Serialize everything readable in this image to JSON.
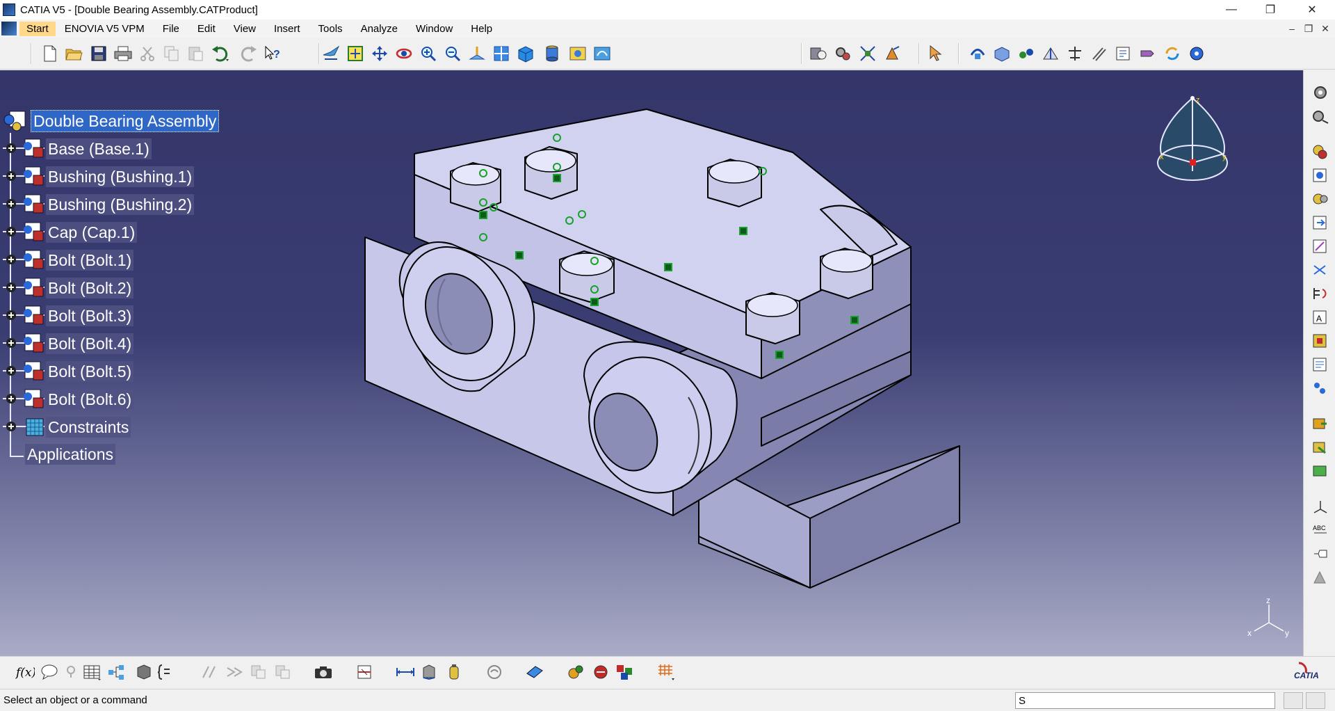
{
  "window": {
    "title": "CATIA V5 - [Double Bearing Assembly.CATProduct]",
    "controls": {
      "minimize": "—",
      "maximize": "❐",
      "close": "✕"
    }
  },
  "menubar": {
    "items": [
      {
        "label": "Start"
      },
      {
        "label": "ENOVIA V5 VPM"
      },
      {
        "label": "File"
      },
      {
        "label": "Edit"
      },
      {
        "label": "View"
      },
      {
        "label": "Insert"
      },
      {
        "label": "Tools"
      },
      {
        "label": "Analyze"
      },
      {
        "label": "Window"
      },
      {
        "label": "Help"
      }
    ],
    "doc_controls": {
      "minimize": "–",
      "restore": "❐",
      "close": "✕"
    }
  },
  "spec_tree": {
    "root": "Double Bearing Assembly",
    "children": [
      {
        "label": "Base (Base.1)",
        "icon": "part-instance-icon"
      },
      {
        "label": "Bushing (Bushing.1)",
        "icon": "part-instance-icon"
      },
      {
        "label": "Bushing (Bushing.2)",
        "icon": "part-instance-icon"
      },
      {
        "label": "Cap (Cap.1)",
        "icon": "part-instance-icon"
      },
      {
        "label": "Bolt (Bolt.1)",
        "icon": "part-instance-icon"
      },
      {
        "label": "Bolt (Bolt.2)",
        "icon": "part-instance-icon"
      },
      {
        "label": "Bolt (Bolt.3)",
        "icon": "part-instance-icon"
      },
      {
        "label": "Bolt (Bolt.4)",
        "icon": "part-instance-icon"
      },
      {
        "label": "Bolt (Bolt.5)",
        "icon": "part-instance-icon"
      },
      {
        "label": "Bolt (Bolt.6)",
        "icon": "part-instance-icon"
      },
      {
        "label": "Constraints",
        "icon": "constraints-icon"
      }
    ],
    "applications": "Applications"
  },
  "compass": {
    "z": "z",
    "x": "x",
    "y": "y"
  },
  "axis_triad": {
    "z": "z",
    "x": "x",
    "y": "y"
  },
  "status": {
    "message": "Select an object or a command",
    "command_value": "S"
  },
  "colors": {
    "viewport_top": "#34366a",
    "viewport_bottom": "#a9abc6",
    "part_face": "#b8b9e0",
    "selection": "#2e67c6",
    "constraint_green": "#17a02c"
  }
}
